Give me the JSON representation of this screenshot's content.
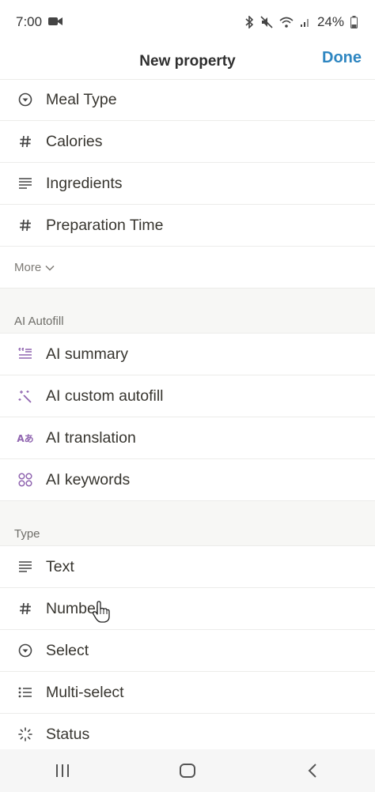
{
  "status": {
    "time": "7:00",
    "battery": "24%"
  },
  "header": {
    "title": "New property",
    "done": "Done"
  },
  "properties": [
    {
      "label": "Meal Type",
      "icon": "select-icon"
    },
    {
      "label": "Calories",
      "icon": "number-icon"
    },
    {
      "label": "Ingredients",
      "icon": "text-icon"
    },
    {
      "label": "Preparation Time",
      "icon": "number-icon"
    }
  ],
  "more_label": "More",
  "ai_section": {
    "title": "AI Autofill",
    "items": [
      {
        "label": "AI summary",
        "icon": "ai-summary-icon"
      },
      {
        "label": "AI custom autofill",
        "icon": "sparkle-wand-icon"
      },
      {
        "label": "AI translation",
        "icon": "translation-icon"
      },
      {
        "label": "AI keywords",
        "icon": "keywords-icon"
      }
    ]
  },
  "type_section": {
    "title": "Type",
    "items": [
      {
        "label": "Text",
        "icon": "text-icon"
      },
      {
        "label": "Number",
        "icon": "number-icon"
      },
      {
        "label": "Select",
        "icon": "select-icon"
      },
      {
        "label": "Multi-select",
        "icon": "multi-select-icon"
      },
      {
        "label": "Status",
        "icon": "status-icon"
      }
    ]
  },
  "translation_icon_text": "Aあ"
}
